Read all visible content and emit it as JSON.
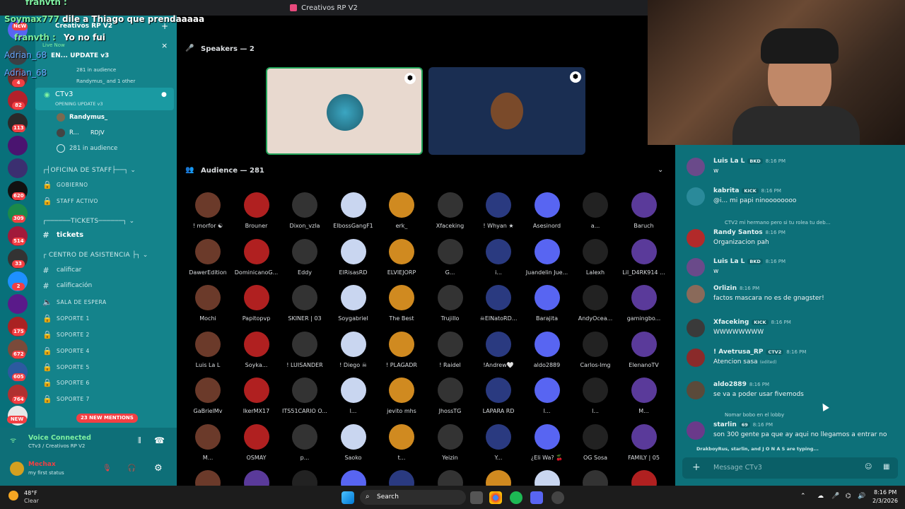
{
  "window": {
    "title": "Creativos RP V2"
  },
  "overlay_chat": [
    {
      "user": "franvth :",
      "text": ""
    },
    {
      "user": "Soymax777 :",
      "text": "dile a Thiago que prendaaaaa"
    },
    {
      "user": "franvth :",
      "text": "Yo no fui"
    },
    {
      "user": "Adrian_68",
      "text": ""
    },
    {
      "user": "Adrian_68",
      "text": ""
    }
  ],
  "server": {
    "name": "Creativos RP V2",
    "live_now": "Live Now",
    "stage_title": "EN... UPDATE v3",
    "audience": "281 in audience",
    "members": "Randymus_ and 1 other"
  },
  "rail_badges": [
    "NEW",
    "4",
    "82",
    "113",
    "620",
    "309",
    "514",
    "33",
    "2",
    "175",
    "672",
    "605",
    "764",
    "NEW"
  ],
  "stage_channel": {
    "name": "CTv3",
    "topic": "OPENING UPDATE v3",
    "speakers": [
      "Randymus_",
      "R...",
      "RDJV"
    ],
    "audience": "281 in audience"
  },
  "categories": {
    "staff": "OFICINA DE STAFF",
    "tickets": "TICKETS",
    "asistencia": "CENTRO DE ASISTENCIA"
  },
  "channels": {
    "gobierno": "GOBIERNO",
    "staff_activo": "STAFF ACTIVO",
    "tickets": "tickets",
    "calificar": "calificar",
    "calificacion": "calificación",
    "sala": "SALA DE ESPERA",
    "soporte": [
      "SOPORTE 1",
      "SOPORTE 2",
      "SOPORTE 4",
      "SOPORTE 5",
      "SOPORTE 6",
      "SOPORTE 7"
    ]
  },
  "new_mentions": "23 NEW MENTIONS",
  "voice": {
    "status": "Voice Connected",
    "channel": "CTv3 / Creativos RP V2"
  },
  "user_panel": {
    "name": "Mechax",
    "status": "my first status"
  },
  "stage": {
    "speakers_header": "Speakers — 2",
    "audience_header": "Audience — 281"
  },
  "audience": [
    "! morfor ☯",
    "Brouner",
    "Dixon_vzla",
    "ElbossGangF1",
    "erk_",
    "Xfaceking",
    "! Whyan ★",
    "Asesinord",
    "a...",
    "Baruch",
    "DawerEdition",
    "DominicanoG...",
    "Eddy",
    "ElRisasRD",
    "ELVIEJORP",
    "G...",
    "i...",
    "Juandelin Jue...",
    "Lalexh",
    "Lil_D4RK914 ...",
    "Mochi",
    "Papitopvp",
    "SKINER | 03",
    "Soygabriel",
    "The Best",
    "Trujillo",
    "☠ElNatoRD...",
    "Barajita",
    "AndyOcea...",
    "gamingbo...",
    "Luis La L",
    "Soyka...",
    "! LUISANDER",
    "! Diego ☠",
    "! PLAGADR",
    "! Raidel",
    "!Andrew🤍",
    "aldo2889",
    "Carlos-lmg",
    "ElenanoTV",
    "GaBrielMv",
    "IkerMX17",
    "ITS51CARIO O...",
    "l...",
    "jevito mhs",
    "JhossTG",
    "LAPARA RD",
    "l...",
    "l...",
    "M...",
    "M...",
    "OSMAY",
    "p...",
    "Saoko",
    "t...",
    "Yeizin",
    "Y...",
    "¿Eli Wa? 🍒",
    "OG Sosa",
    "FAMILY | 05"
  ],
  "chat": {
    "messages": [
      {
        "name": "Luis La L",
        "tag": "BKD",
        "time": "8:16 PM",
        "text": "w"
      },
      {
        "name": "kabrita",
        "tag": "KICK",
        "time": "8:16 PM",
        "text": "@i... mi papi ninoooooooo"
      },
      {
        "reply": "CTV2  mi hermano pero si tu rolea tu deb...",
        "name": "Randy Santos",
        "time": "8:16 PM",
        "text": "Organizacion pah"
      },
      {
        "name": "Luis La L",
        "tag": "BKD",
        "time": "8:16 PM",
        "text": "w"
      },
      {
        "name": "Orlizin",
        "time": "8:16 PM",
        "text": "factos mascara no es de gnagster!"
      },
      {
        "name": "Xfaceking",
        "tag": "KICK",
        "time": "8:16 PM",
        "text": "WWWWWWWW"
      },
      {
        "name": "! Avetrusa_RP",
        "tag": "CTV2",
        "time": "8:16 PM",
        "text": "Atencion sasa",
        "edited": "(edited)"
      },
      {
        "name": "aldo2889",
        "time": "8:16 PM",
        "text": "se va a poder usar fivemods"
      },
      {
        "reply": "Nomar  bobo en el lobby",
        "name": "starlin",
        "tag": "69",
        "time": "8:16 PM",
        "text": "son 300 gente pa que ay aqui no llegamos a entrar no"
      }
    ],
    "typing": "DrakboyRus, starlin, and J O N A S are typing...",
    "placeholder": "Message CTv3"
  },
  "taskbar": {
    "temp": "48°F",
    "weather": "Clear",
    "search": "Search",
    "time": "8:16 PM",
    "date": "2/3/2026"
  }
}
